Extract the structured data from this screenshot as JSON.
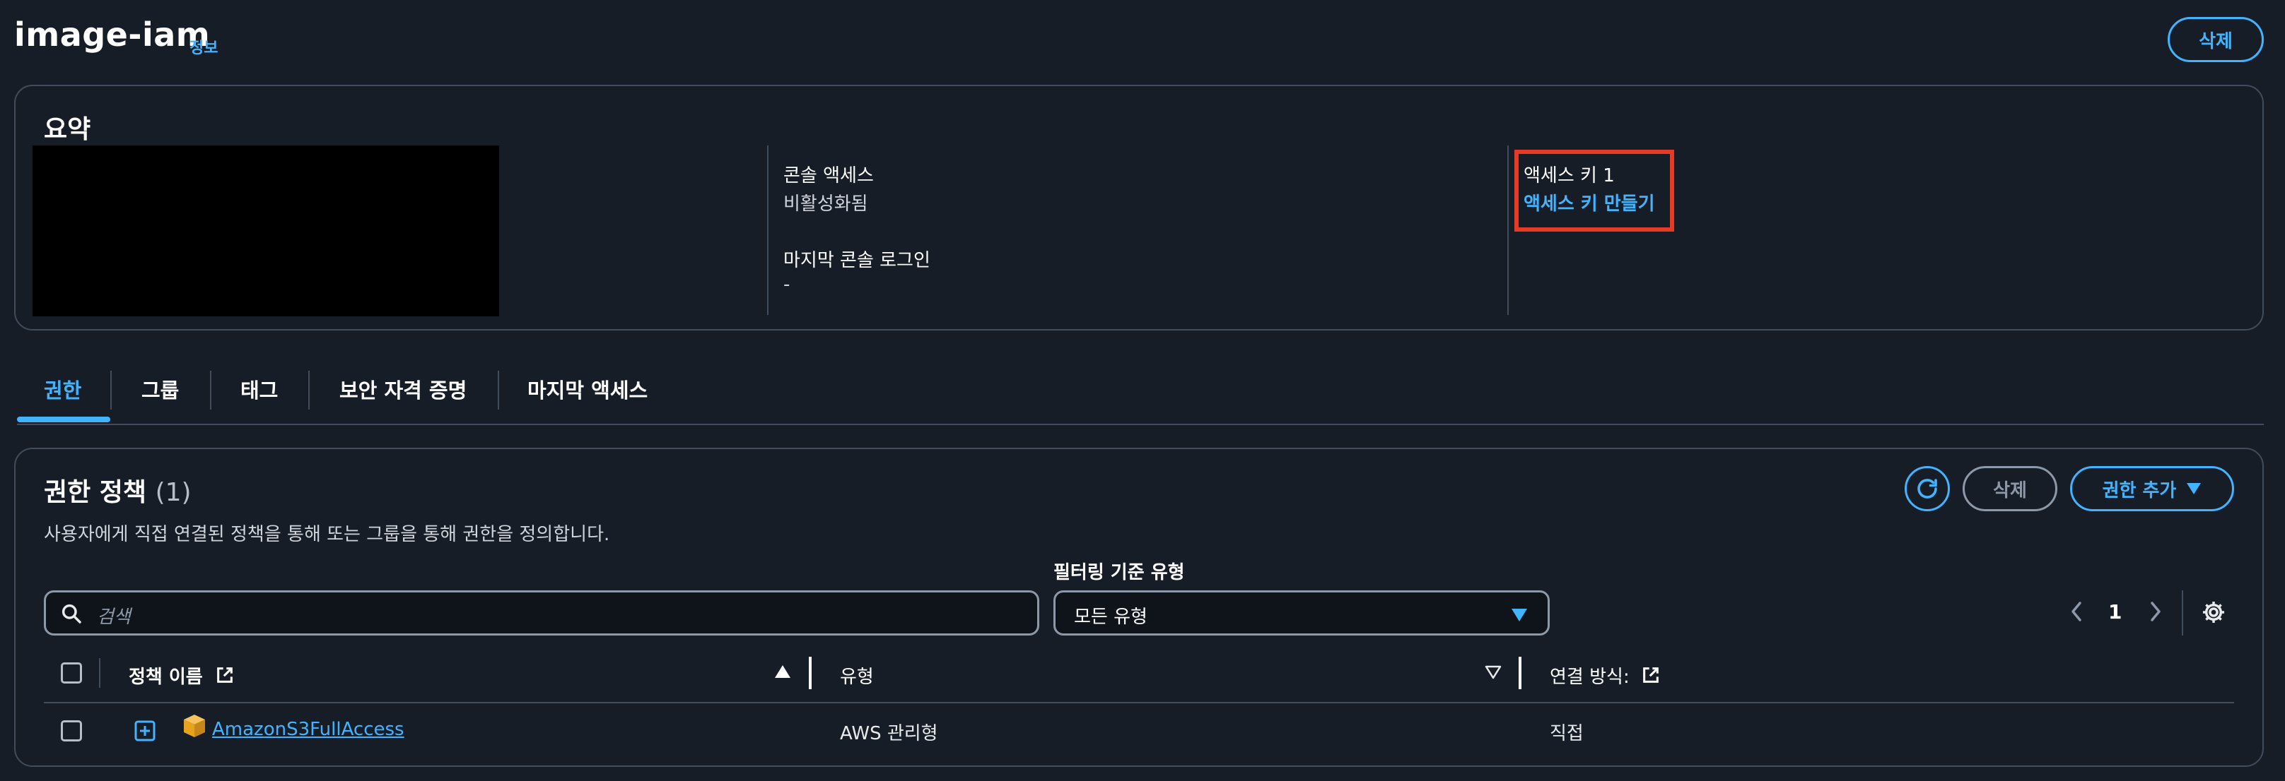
{
  "header": {
    "title": "image-iam",
    "info_link": "정보",
    "delete_button": "삭제"
  },
  "summary": {
    "heading": "요약",
    "console_access_label": "콘솔 액세스",
    "console_access_value": "비활성화됨",
    "last_console_login_label": "마지막 콘솔 로그인",
    "last_console_login_value": "-",
    "access_key_label": "액세스 키 1",
    "create_access_key_link": "액세스 키 만들기"
  },
  "tabs": [
    {
      "label": "권한",
      "active": true
    },
    {
      "label": "그룹",
      "active": false
    },
    {
      "label": "태그",
      "active": false
    },
    {
      "label": "보안 자격 증명",
      "active": false
    },
    {
      "label": "마지막 액세스",
      "active": false
    }
  ],
  "permissions": {
    "heading": "권한 정책",
    "count": "(1)",
    "description": "사용자에게 직접 연결된 정책을 통해 또는 그룹을 통해 권한을 정의합니다.",
    "delete_button": "삭제",
    "add_permission_button": "권한 추가",
    "search_placeholder": "검색",
    "filter_label": "필터링 기준 유형",
    "filter_value": "모든 유형",
    "page_number": "1",
    "columns": {
      "policy_name": "정책 이름",
      "type": "유형",
      "attached_via": "연결 방식:"
    },
    "rows": [
      {
        "policy_name": "AmazonS3FullAccess",
        "type": "AWS 관리형",
        "attached_via": "직접"
      }
    ]
  },
  "colors": {
    "accent": "#42b4ff",
    "background": "#161d26",
    "highlight_box": "#e53b25"
  }
}
